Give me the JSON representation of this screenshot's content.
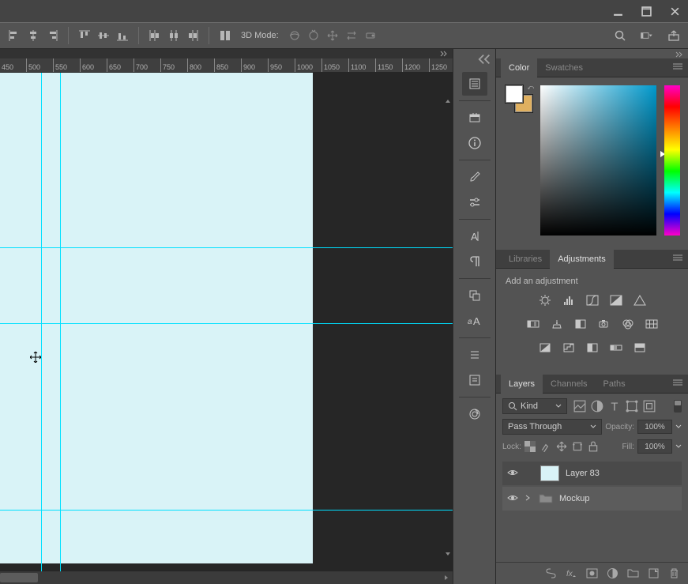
{
  "window": {
    "minimize": "—",
    "maximize": "❐",
    "close": "✕"
  },
  "options_bar": {
    "mode_label": "3D Mode:"
  },
  "ruler": {
    "ticks": [
      450,
      500,
      550,
      600,
      650,
      700,
      750,
      800,
      850,
      900,
      950,
      1000,
      1050,
      1100,
      1150,
      1200,
      1250
    ]
  },
  "panels": {
    "color": {
      "tabs": {
        "color": "Color",
        "swatches": "Swatches"
      }
    },
    "adjustments": {
      "tabs": {
        "libraries": "Libraries",
        "adjustments": "Adjustments"
      },
      "heading": "Add an adjustment"
    },
    "layers": {
      "tabs": {
        "layers": "Layers",
        "channels": "Channels",
        "paths": "Paths"
      },
      "filter_kind": "Kind",
      "blend_mode": "Pass Through",
      "opacity_label": "Opacity:",
      "opacity_value": "100%",
      "fill_label": "Fill:",
      "fill_value": "100%",
      "lock_label": "Lock:",
      "items": [
        {
          "name": "Layer 83",
          "type": "layer"
        },
        {
          "name": "Mockup",
          "type": "group"
        }
      ]
    }
  }
}
